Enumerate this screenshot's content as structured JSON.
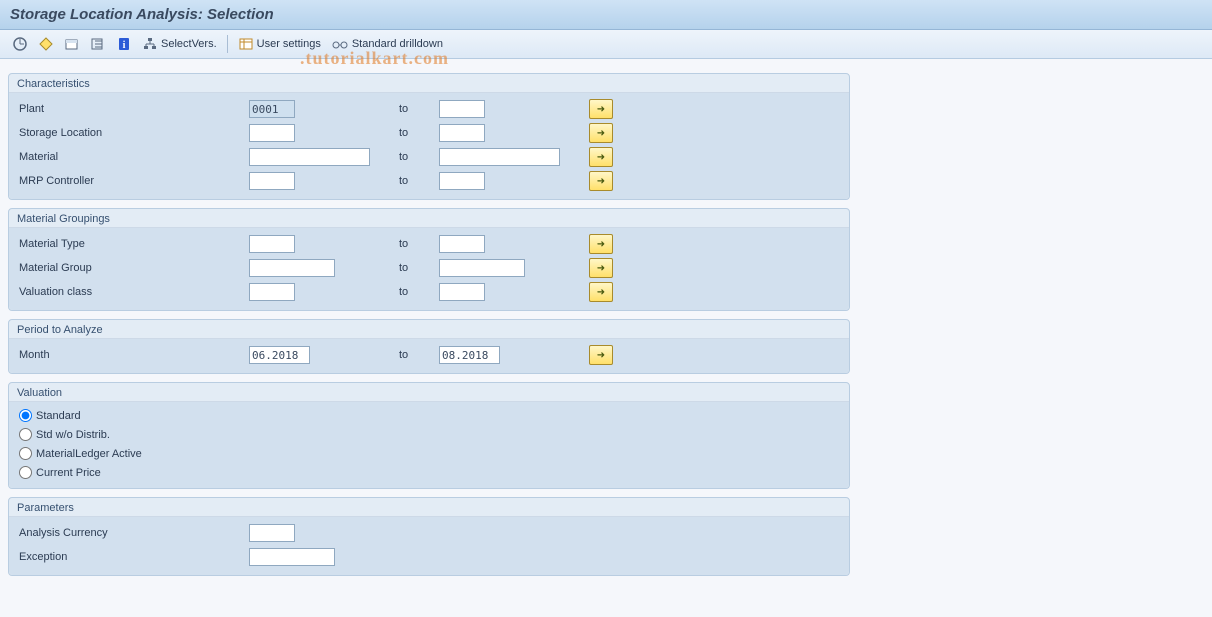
{
  "title": "Storage Location Analysis: Selection",
  "watermark": ".tutorialkart.com",
  "toolbar": {
    "selectvers": "SelectVers.",
    "usersettings": "User settings",
    "stddrill": "Standard drilldown"
  },
  "groups": {
    "characteristics": {
      "title": "Characteristics",
      "rows": {
        "plant": {
          "label": "Plant",
          "from": "0001",
          "to_label": "to",
          "to": ""
        },
        "storloc": {
          "label": "Storage Location",
          "from": "",
          "to_label": "to",
          "to": ""
        },
        "material": {
          "label": "Material",
          "from": "",
          "to_label": "to",
          "to": ""
        },
        "mrp": {
          "label": "MRP Controller",
          "from": "",
          "to_label": "to",
          "to": ""
        }
      }
    },
    "matgroupings": {
      "title": "Material Groupings",
      "rows": {
        "mtype": {
          "label": "Material Type",
          "from": "",
          "to_label": "to",
          "to": ""
        },
        "mgroup": {
          "label": "Material Group",
          "from": "",
          "to_label": "to",
          "to": ""
        },
        "valcls": {
          "label": "Valuation class",
          "from": "",
          "to_label": "to",
          "to": ""
        }
      }
    },
    "period": {
      "title": "Period to Analyze",
      "rows": {
        "month": {
          "label": "Month",
          "from": "06.2018",
          "to_label": "to",
          "to": "08.2018"
        }
      }
    },
    "valuation": {
      "title": "Valuation",
      "options": {
        "std": "Standard",
        "stdwo": "Std w/o Distrib.",
        "ml": "MaterialLedger Active",
        "cp": "Current Price"
      }
    },
    "parameters": {
      "title": "Parameters",
      "rows": {
        "curr": {
          "label": "Analysis Currency",
          "value": ""
        },
        "exc": {
          "label": "Exception",
          "value": ""
        }
      }
    }
  }
}
